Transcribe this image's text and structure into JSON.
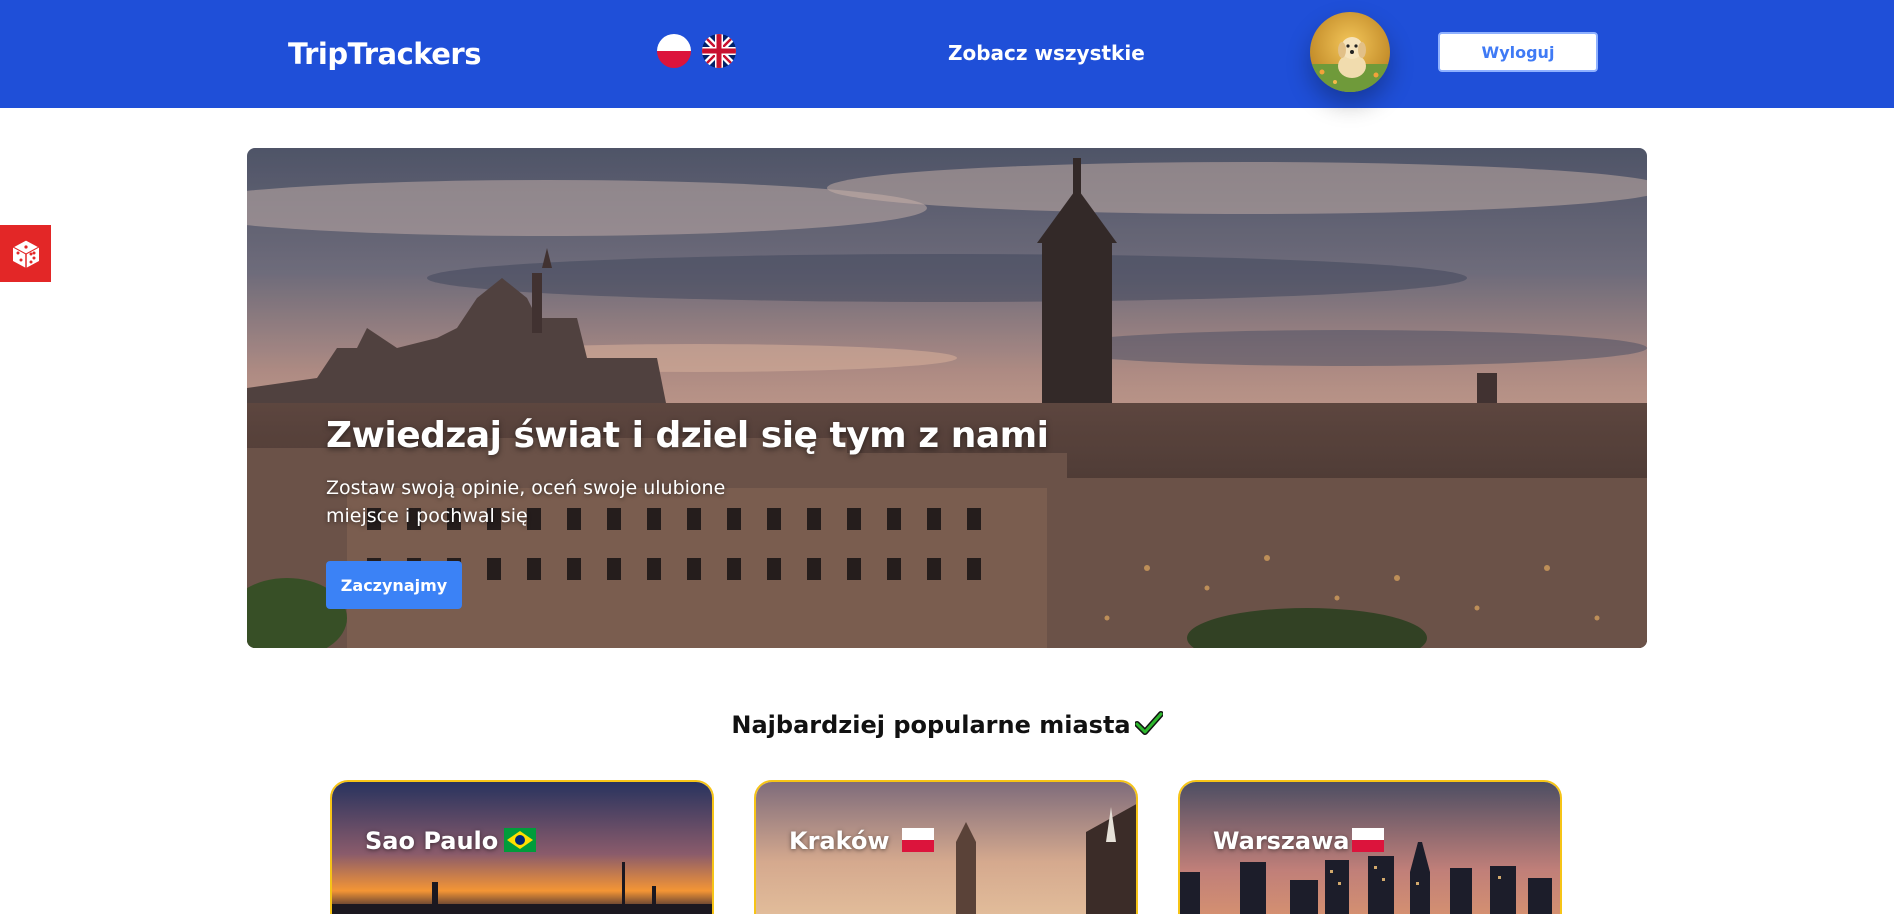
{
  "header": {
    "brand": "TripTrackers",
    "nav_all": "Zobacz wszystkie",
    "logout": "Wyloguj",
    "accent": "#1f4fd8"
  },
  "languages": [
    {
      "code": "pl",
      "icon": "poland-flag-icon"
    },
    {
      "code": "en",
      "icon": "uk-flag-icon"
    }
  ],
  "hero": {
    "title": "Zwiedzaj świat i dziel się tym z nami",
    "subtitle": "Zostaw swoją opinie, oceń swoje ulubione miejsce i pochwal się",
    "cta": "Zaczynajmy",
    "cta_color": "#3b82f6"
  },
  "popular": {
    "title": "Najbardziej popularne miasta",
    "cities": [
      {
        "name": "Sao Paulo",
        "country_flag": "brazil-flag-icon"
      },
      {
        "name": "Kraków",
        "country_flag": "poland-flag-icon"
      },
      {
        "name": "Warszawa",
        "country_flag": "poland-flag-icon"
      }
    ],
    "card_border": "#f6c417"
  }
}
